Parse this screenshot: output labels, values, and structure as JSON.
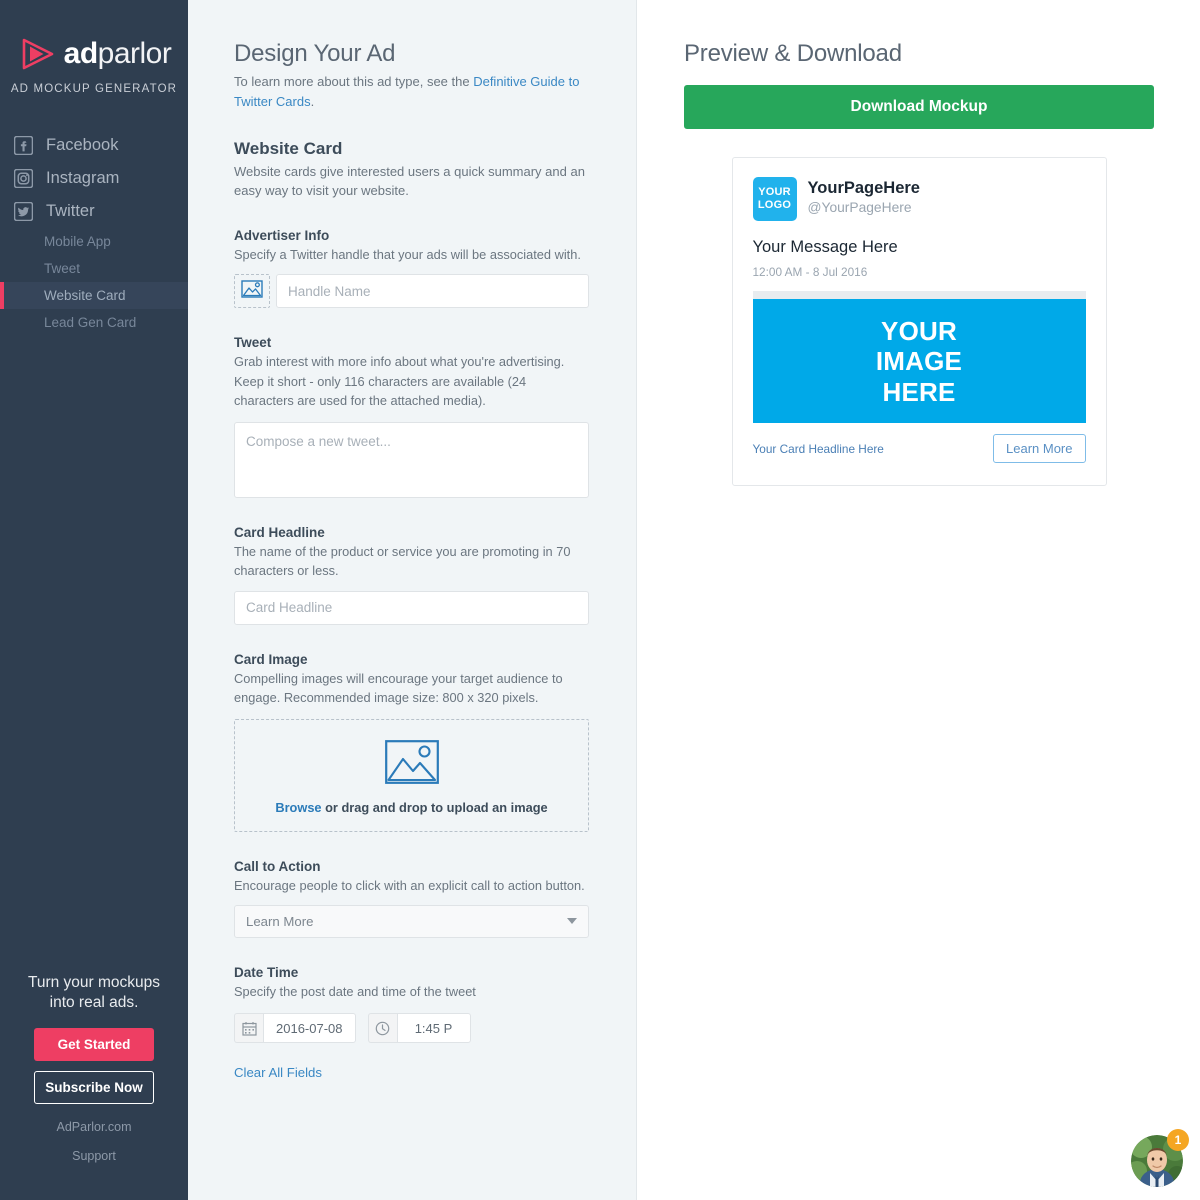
{
  "sidebar": {
    "logo": {
      "word_bold": "ad",
      "word_light": "parlor",
      "icon": "play-triangle-icon"
    },
    "tagline": "AD MOCKUP GENERATOR",
    "nav": [
      {
        "label": "Facebook",
        "icon": "facebook-icon"
      },
      {
        "label": "Instagram",
        "icon": "instagram-icon"
      },
      {
        "label": "Twitter",
        "icon": "twitter-icon"
      }
    ],
    "subnav": [
      {
        "label": "Mobile App",
        "active": false
      },
      {
        "label": "Tweet",
        "active": false
      },
      {
        "label": "Website Card",
        "active": true
      },
      {
        "label": "Lead Gen Card",
        "active": false
      }
    ],
    "footer": {
      "headline": "Turn your mockups into real ads.",
      "get_started": "Get Started",
      "subscribe": "Subscribe Now",
      "site_link": "AdParlor.com",
      "support_link": "Support"
    },
    "colors": {
      "background": "#2f3e50",
      "accent_pink": "#ee3e63",
      "active_item_bg": "#36455a"
    }
  },
  "form": {
    "title": "Design Your Ad",
    "lede_prefix": "To learn more about this ad type, see the ",
    "lede_link": "Definitive Guide to Twitter Cards",
    "lede_suffix": ".",
    "card_type_title": "Website Card",
    "card_type_desc": "Website cards give interested users a quick summary and an easy way to visit your website.",
    "advertiser": {
      "label": "Advertiser Info",
      "desc": "Specify a Twitter handle that your ads will be associated with.",
      "image_chip_icon": "image-placeholder-icon",
      "handle_placeholder": "Handle Name",
      "handle_value": ""
    },
    "tweet": {
      "label": "Tweet",
      "desc": "Grab interest with more info about what you're advertising. Keep it short - only 116 characters are available (24 characters are used for the attached media).",
      "placeholder": "Compose a new tweet...",
      "value": ""
    },
    "card_headline": {
      "label": "Card Headline",
      "desc": "The name of the product or service you are promoting in 70 characters or less.",
      "placeholder": "Card Headline",
      "value": ""
    },
    "card_image": {
      "label": "Card Image",
      "desc": "Compelling images will encourage your target audience to engage. Recommended image size: 800 x 320 pixels.",
      "icon": "image-placeholder-icon",
      "browse_label": "Browse",
      "drop_text": " or drag and drop to upload an image"
    },
    "call_to_action": {
      "label": "Call to Action",
      "desc": "Encourage people to click with an explicit call to action button.",
      "selected": "Learn More"
    },
    "date_time": {
      "label": "Date Time",
      "desc": "Specify the post date and time of the tweet",
      "date_icon": "calendar-icon",
      "date_value": "2016-07-08",
      "time_icon": "clock-icon",
      "time_value": "1:45 P"
    },
    "clear_all": "Clear All Fields"
  },
  "preview": {
    "title": "Preview & Download",
    "download_label": "Download Mockup",
    "download_color": "#27a75b",
    "card": {
      "avatar_line1": "YOUR",
      "avatar_line2": "LOGO",
      "display_name": "YourPageHere",
      "handle": "@YourPageHere",
      "message": "Your Message Here",
      "timestamp": "12:00 AM - 8 Jul 2016",
      "image_line1": "YOUR",
      "image_line2": "IMAGE",
      "image_line3": "HERE",
      "image_color": "#00a9e8",
      "headline": "Your Card Headline Here",
      "cta_label": "Learn More"
    }
  },
  "chat": {
    "badge_count": "1",
    "avatar": "support-agent-avatar",
    "badge_color": "#f5a623"
  }
}
